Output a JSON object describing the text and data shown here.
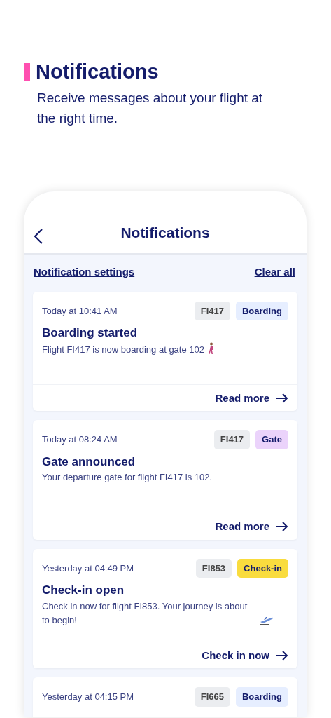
{
  "header": {
    "title": "Notifications",
    "subtitle": "Receive messages about your flight at the right time."
  },
  "screen": {
    "title": "Notifications",
    "links": [
      "Notification settings",
      "Clear all"
    ]
  },
  "notifications": [
    {
      "time": "Today at 10:41 AM",
      "flight": "FI417",
      "status": "Boarding",
      "color": "#e6eeff",
      "title": "Boarding started",
      "message": "Flight FI417 is now boarding at gate 102",
      "kind": "walking",
      "action": "Read more"
    },
    {
      "time": "Today at 08:24 AM",
      "flight": "FI417",
      "status": "Gate",
      "color": "#ebd3fb",
      "title": "Gate announced",
      "message": "Your departure gate for flight FI417 is 102.",
      "action": "Read more"
    },
    {
      "time": "Yesterday at 04:49 PM",
      "flight": "FI853",
      "status": "Check-in",
      "color": "#f9dc3e",
      "title": "Check-in open",
      "message": "Check in now for flight FI853. Your journey is about to begin!",
      "kind": "plane",
      "action": "Check in now"
    },
    {
      "time": "Yesterday at 04:15 PM",
      "flight": "FI665",
      "status": "Boarding",
      "color": "#e6eeff"
    }
  ]
}
